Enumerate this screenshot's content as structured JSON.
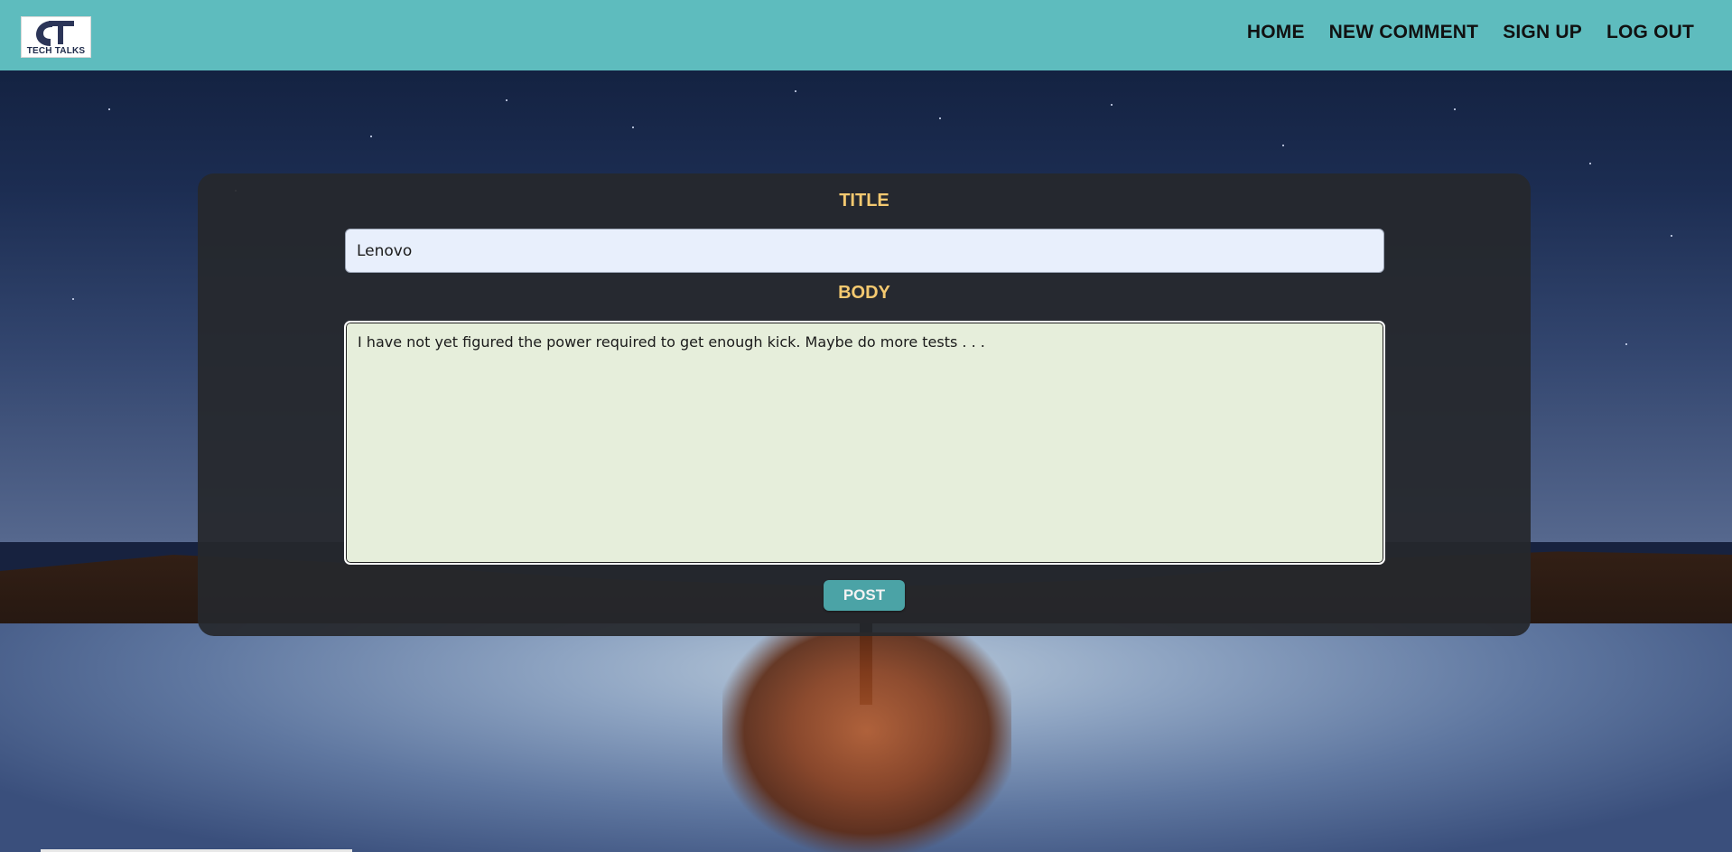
{
  "logo": {
    "text": "TECH TALKS"
  },
  "nav": {
    "items": [
      {
        "label": "HOME"
      },
      {
        "label": "NEW COMMENT"
      },
      {
        "label": "SIGN UP"
      },
      {
        "label": "LOG OUT"
      }
    ]
  },
  "form": {
    "title_label": "TITLE",
    "title_value": "Lenovo",
    "body_label": "BODY",
    "body_value": "I have not yet figured the power required to get enough kick. Maybe do more tests . . . ",
    "submit_label": "POST"
  },
  "colors": {
    "navbar": "#5ebcbe",
    "label_accent": "#f4c970",
    "button": "#4ba3a6",
    "card": "#26282c"
  }
}
